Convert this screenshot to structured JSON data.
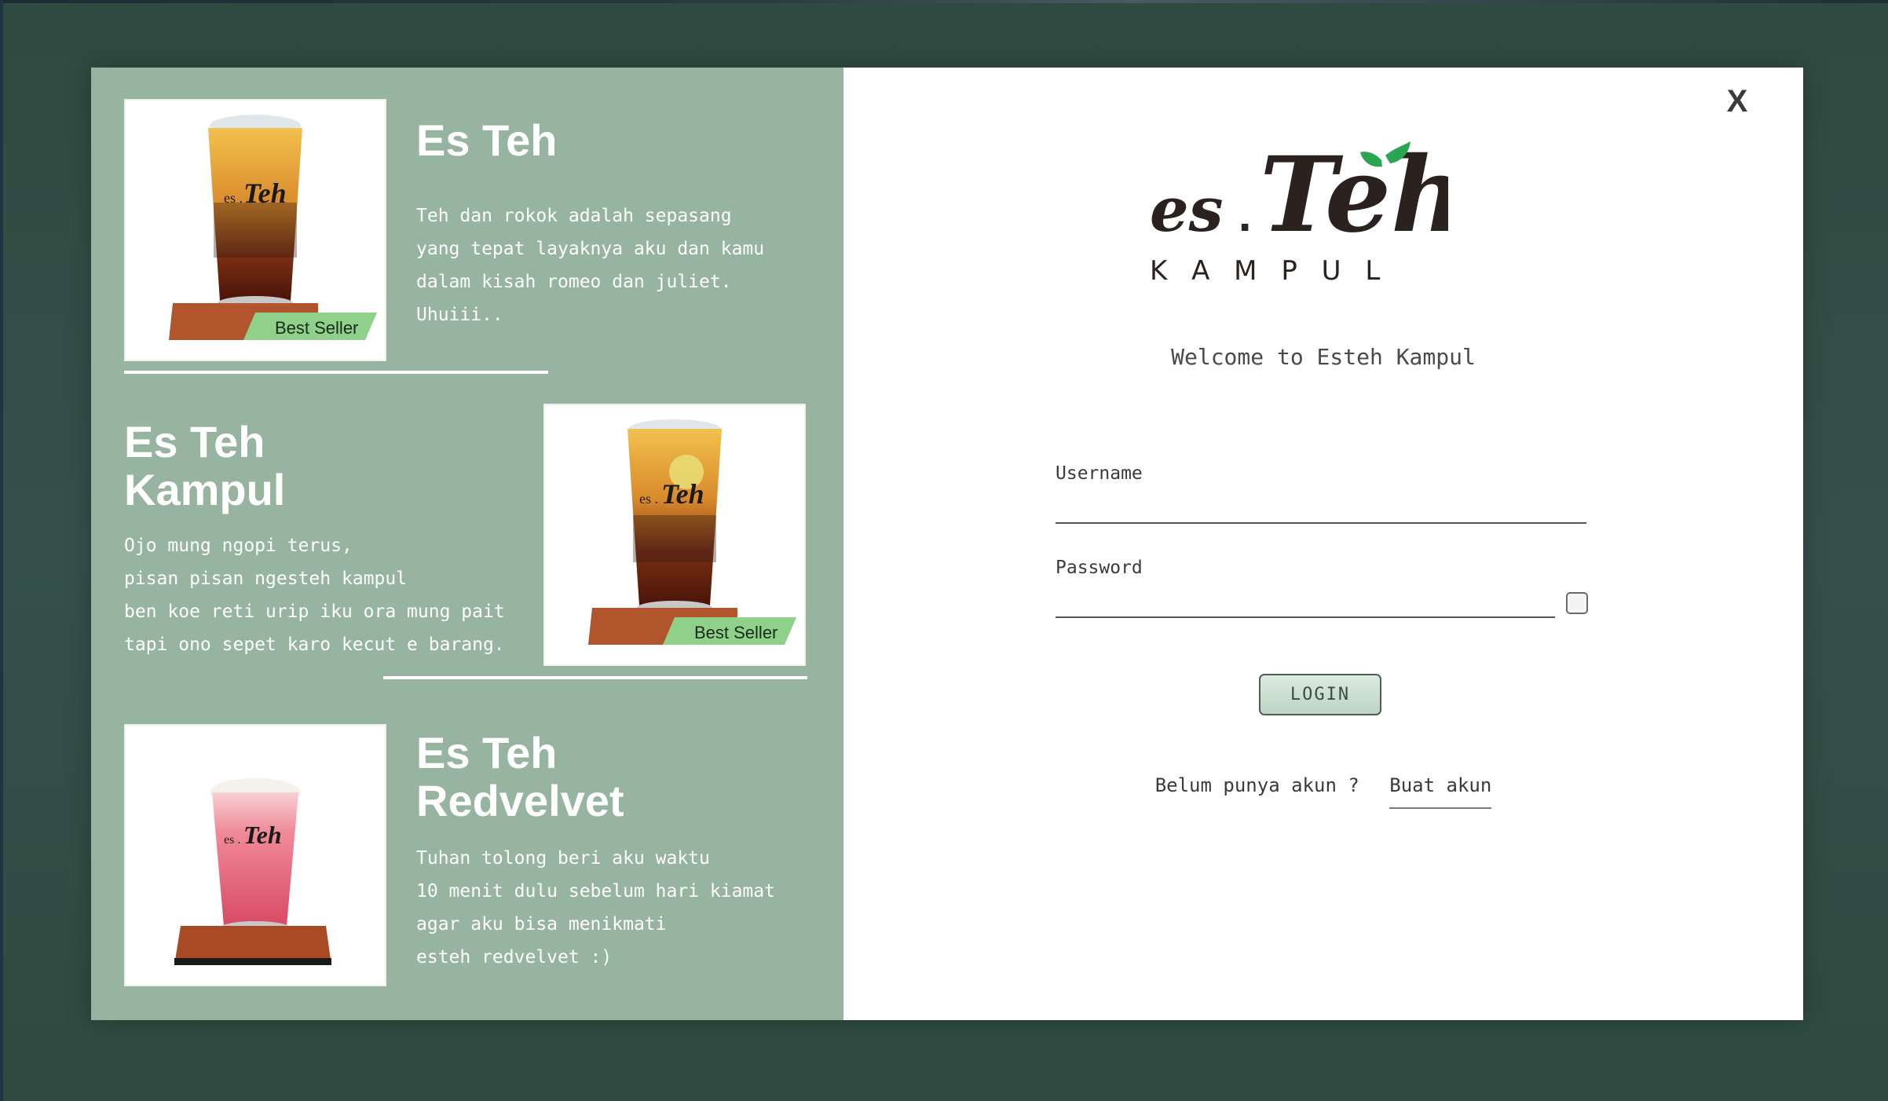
{
  "colors": {
    "backdrop": "#344f44",
    "left_panel": "#97b4a0",
    "right_panel": "#ffffff",
    "accent_green": "#8fd08a",
    "text_white": "#ffffff"
  },
  "products": [
    {
      "title": "Es Teh",
      "description": "Teh dan rokok adalah sepasang\nyang tepat layaknya aku dan kamu\ndalam kisah romeo dan juliet.\nUhuiii..",
      "badge": "Best Seller",
      "icon": "iced-tea-cup-image"
    },
    {
      "title": "Es Teh\nKampul",
      "description": "Ojo mung ngopi terus,\npisan pisan ngesteh kampul\nben koe reti urip iku ora mung pait\ntapi ono sepet karo kecut e barang.",
      "badge": "Best Seller",
      "icon": "iced-tea-lemon-image"
    },
    {
      "title": "Es Teh\nRedvelvet",
      "description": "Tuhan tolong beri aku waktu\n10 menit dulu sebelum hari kiamat\nagar aku bisa menikmati\nesteh redvelvet :)",
      "icon": "redvelvet-cup-image"
    }
  ],
  "login": {
    "close_label": "X",
    "logo": {
      "es": "es",
      "dot": ".",
      "teh": "Teh",
      "tagline": "K A M P U L"
    },
    "welcome": "Welcome to Esteh Kampul",
    "username_label": "Username",
    "username_value": "",
    "password_label": "Password",
    "password_value": "",
    "button_label": "LOGIN",
    "no_account_text": "Belum punya akun ?",
    "signup_link": "Buat akun"
  }
}
